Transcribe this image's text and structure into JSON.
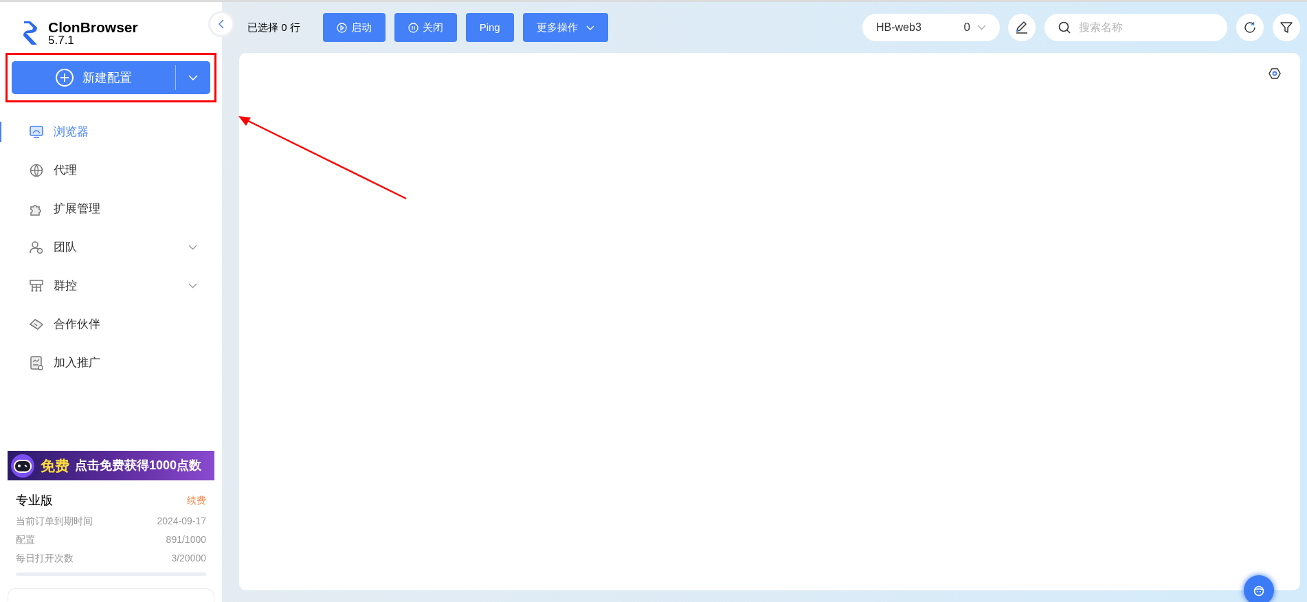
{
  "app": {
    "name": "ClonBrowser",
    "version": "5.7.1"
  },
  "new_config_button": {
    "label": "新建配置"
  },
  "nav": [
    {
      "label": "浏览器",
      "selected": true,
      "expandable": false
    },
    {
      "label": "代理",
      "selected": false,
      "expandable": false
    },
    {
      "label": "扩展管理",
      "selected": false,
      "expandable": false
    },
    {
      "label": "团队",
      "selected": false,
      "expandable": true
    },
    {
      "label": "群控",
      "selected": false,
      "expandable": true
    },
    {
      "label": "合作伙伴",
      "selected": false,
      "expandable": false
    },
    {
      "label": "加入推广",
      "selected": false,
      "expandable": false
    }
  ],
  "promo_banner": {
    "badge": "免费",
    "text": "点击免费获得1000点数"
  },
  "plan": {
    "name": "专业版",
    "renew_link": "续费",
    "rows": [
      {
        "label": "当前订单到期时间",
        "value": "2024-09-17"
      },
      {
        "label": "配置",
        "value": "891/1000"
      },
      {
        "label": "每日打开次数",
        "value": "3/20000"
      }
    ]
  },
  "toolbar": {
    "selection": "已选择 0 行",
    "buttons": [
      {
        "label": "启动",
        "kind": "play"
      },
      {
        "label": "关闭",
        "kind": "pause"
      },
      {
        "label": "Ping",
        "kind": "plain"
      },
      {
        "label": "更多操作",
        "kind": "menu"
      }
    ],
    "group_select": {
      "value": "HB-web3",
      "count": "0"
    },
    "search": {
      "placeholder": "搜索名称"
    }
  }
}
